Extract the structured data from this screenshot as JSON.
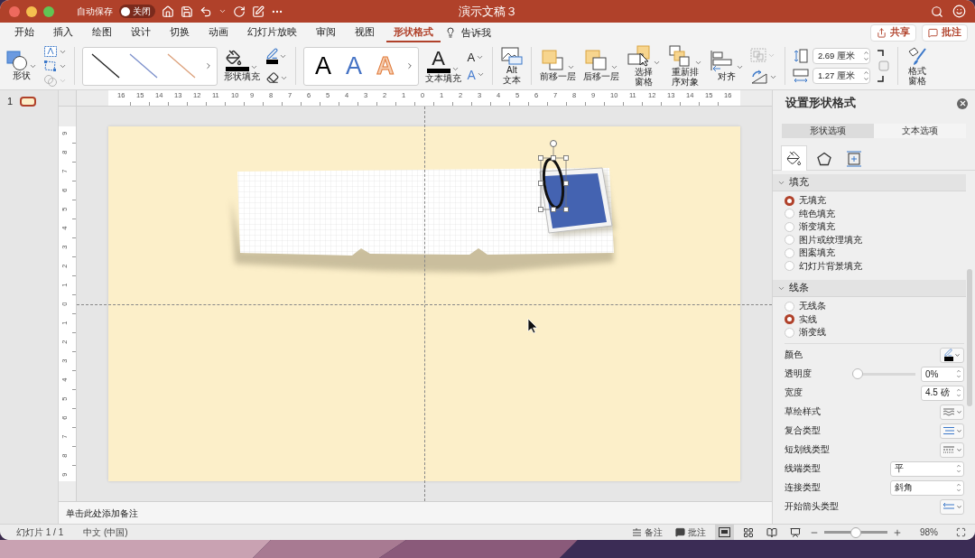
{
  "window": {
    "title": "演示文稿３"
  },
  "autosave": {
    "label": "自动保存",
    "on": false,
    "state_label": "关闭"
  },
  "menu_tabs": [
    {
      "label": "开始",
      "selected": false
    },
    {
      "label": "插入",
      "selected": false
    },
    {
      "label": "绘图",
      "selected": false
    },
    {
      "label": "设计",
      "selected": false
    },
    {
      "label": "切换",
      "selected": false
    },
    {
      "label": "动画",
      "selected": false
    },
    {
      "label": "幻灯片放映",
      "selected": false
    },
    {
      "label": "审阅",
      "selected": false
    },
    {
      "label": "视图",
      "selected": false
    },
    {
      "label": "形状格式",
      "selected": true
    }
  ],
  "tell_me": "告诉我",
  "share_button": "共享",
  "comments_button": "批注",
  "ribbon": {
    "shape_button": "形状",
    "shape_tools": [
      {
        "kind": "textbox",
        "disabled": false
      },
      {
        "kind": "edit",
        "disabled": false
      },
      {
        "kind": "merge",
        "disabled": true
      }
    ],
    "shape_styles": [
      {
        "color": "#1f1f1f"
      },
      {
        "color": "#7b8fcb"
      },
      {
        "color": "#dca07a"
      }
    ],
    "shape_fill": "形状填充",
    "wordart": [
      {
        "text": "A",
        "kind": "solid"
      },
      {
        "text": "A",
        "kind": "blue"
      },
      {
        "text": "A",
        "kind": "outline"
      }
    ],
    "text_fill": {
      "glyph": "A",
      "label": "文本填充"
    },
    "text_outline": {
      "glyph": "A"
    },
    "text_effects": {
      "glyph": "A"
    },
    "alt_text": [
      "Alt",
      "文本"
    ],
    "arrange": [
      {
        "kind": "forward",
        "lines": [
          "前移一层"
        ]
      },
      {
        "kind": "backward",
        "lines": [
          "后移一层"
        ]
      },
      {
        "kind": "pane",
        "lines": [
          "选择",
          "窗格"
        ]
      },
      {
        "kind": "reorder",
        "lines": [
          "重新排",
          "序对象"
        ]
      },
      {
        "kind": "align",
        "lines": [
          "对齐"
        ]
      }
    ],
    "arrange_tools": [
      {
        "kind": "group",
        "disabled": true
      },
      {
        "kind": "rotate",
        "disabled": false
      }
    ],
    "size": [
      {
        "kind": "height",
        "value": "2.69 厘米"
      },
      {
        "kind": "width",
        "value": "1.27 厘米"
      }
    ],
    "format_pane": [
      "格式",
      "窗格"
    ]
  },
  "thumbnails": [
    {
      "number": "1",
      "selected": true
    }
  ],
  "rulers": {
    "horizontal": [
      "16",
      "15",
      "14",
      "13",
      "12",
      "11",
      "10",
      "9",
      "8",
      "7",
      "6",
      "5",
      "4",
      "3",
      "2",
      "1",
      "0",
      "1",
      "2",
      "3",
      "4",
      "5",
      "6",
      "7",
      "8",
      "9",
      "10",
      "11",
      "12",
      "13",
      "14",
      "15",
      "16"
    ],
    "vertical": [
      "9",
      "8",
      "7",
      "6",
      "5",
      "4",
      "3",
      "2",
      "1",
      "0",
      "1",
      "2",
      "3",
      "4",
      "5",
      "6",
      "7",
      "8",
      "9"
    ]
  },
  "notes": {
    "placeholder": "单击此处添加备注"
  },
  "format_pane": {
    "title": "设置形状格式",
    "tabs": [
      {
        "label": "形状选项",
        "selected": true
      },
      {
        "label": "文本选项",
        "selected": false
      }
    ],
    "icon_tabs": [
      {
        "kind": "fill",
        "selected": true
      },
      {
        "kind": "shape",
        "selected": false
      },
      {
        "kind": "size",
        "selected": false
      }
    ],
    "sections": [
      {
        "title": "填充",
        "expanded": true,
        "options": [
          {
            "label": "无填充",
            "selected": true
          },
          {
            "label": "纯色填充",
            "selected": false
          },
          {
            "label": "渐变填充",
            "selected": false
          },
          {
            "label": "图片或纹理填充",
            "selected": false
          },
          {
            "label": "图案填充",
            "selected": false
          },
          {
            "label": "幻灯片背景填充",
            "selected": false
          }
        ]
      },
      {
        "title": "线条",
        "expanded": true,
        "options": [
          {
            "label": "无线条",
            "selected": false
          },
          {
            "label": "实线",
            "selected": true
          },
          {
            "label": "渐变线",
            "selected": false
          }
        ],
        "properties": [
          {
            "kind": "color",
            "label": "颜色"
          },
          {
            "kind": "slider",
            "label": "透明度",
            "level": 0,
            "value": "0%"
          },
          {
            "kind": "spinner",
            "label": "宽度",
            "value": "4.5 磅"
          },
          {
            "kind": "sketch",
            "label": "草绘样式"
          },
          {
            "kind": "compound",
            "label": "复合类型"
          },
          {
            "kind": "dash",
            "label": "短划线类型"
          },
          {
            "kind": "select",
            "label": "线端类型",
            "value": "平"
          },
          {
            "kind": "select",
            "label": "连接类型",
            "value": "斜角"
          },
          {
            "kind": "arrow",
            "label": "开始箭头类型"
          }
        ]
      }
    ]
  },
  "status_bar": {
    "slide": "幻灯片 1 / 1",
    "language": "中文 (中国)",
    "notes_button": "备注",
    "comments_button": "批注",
    "views": [
      {
        "kind": "normal",
        "selected": true
      },
      {
        "kind": "sorter",
        "selected": false
      },
      {
        "kind": "reading",
        "selected": false
      },
      {
        "kind": "slideshow",
        "selected": false
      }
    ],
    "zoom": {
      "level": 0.5,
      "value": "98%"
    }
  }
}
